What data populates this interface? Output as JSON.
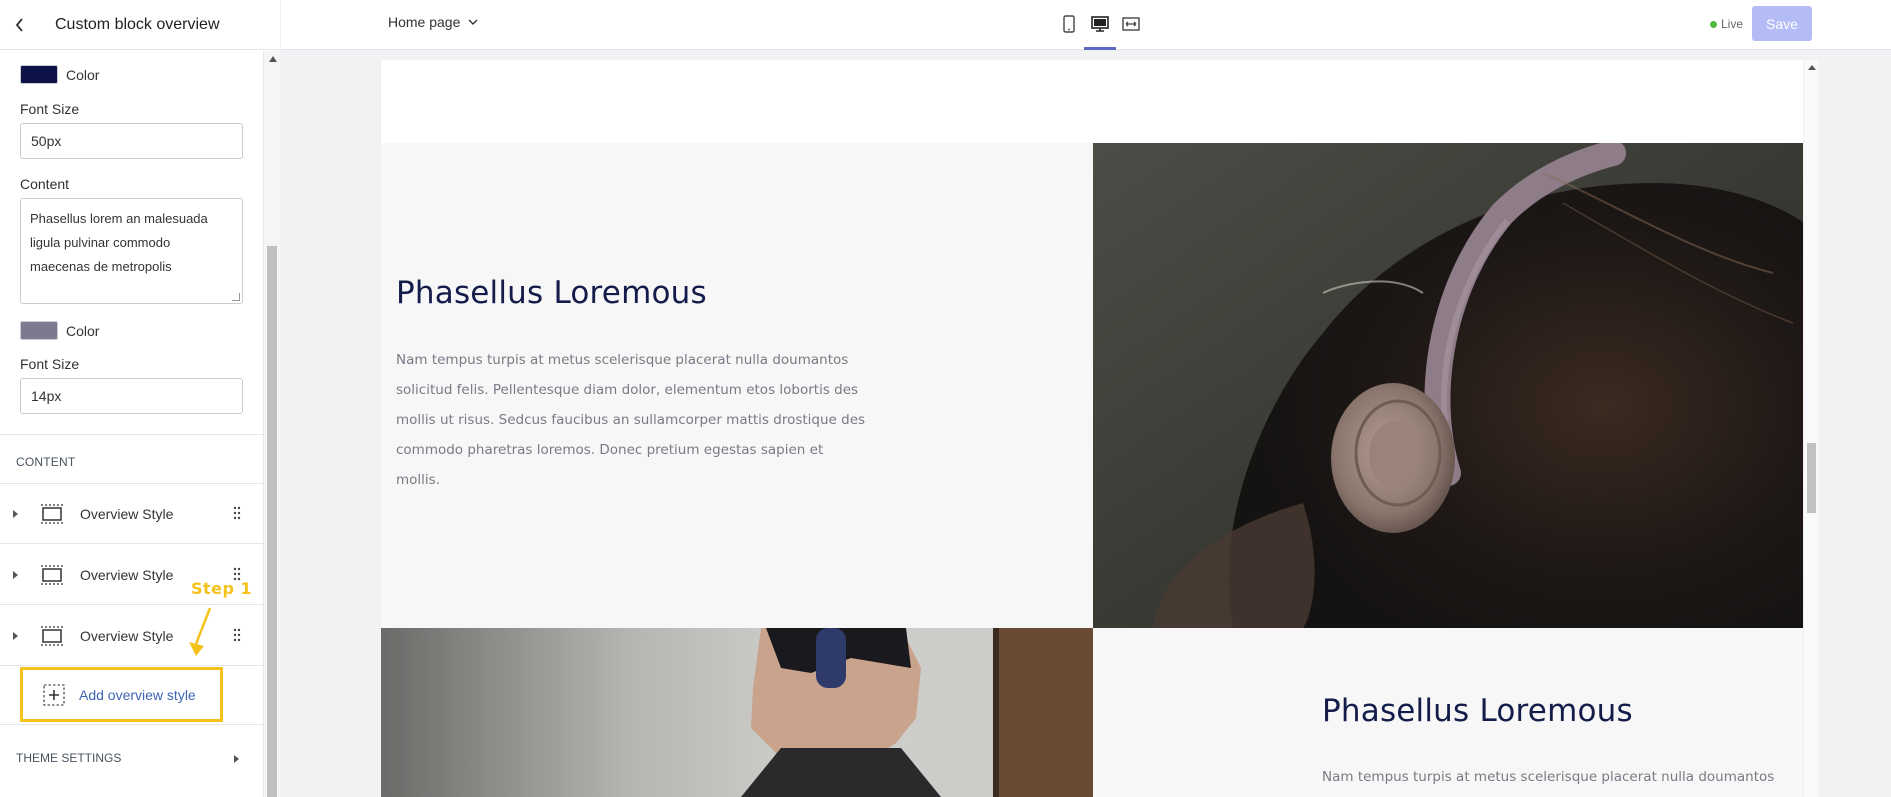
{
  "sidebar": {
    "title": "Custom block overview",
    "heading_color": {
      "label": "Color",
      "value": "#0e1347"
    },
    "heading_font_size": {
      "label": "Font Size",
      "value": "50px"
    },
    "content": {
      "label": "Content",
      "value": "Phasellus lorem an malesuada ligula pulvinar commodo maecenas de metropolis"
    },
    "content_color": {
      "label": "Color",
      "value": "#7b7a8e"
    },
    "content_font_size": {
      "label": "Font Size",
      "value": "14px"
    },
    "content_section": "CONTENT",
    "items": [
      {
        "label": "Overview Style"
      },
      {
        "label": "Overview Style"
      },
      {
        "label": "Overview Style"
      }
    ],
    "add_label": "Add overview style",
    "theme_settings": "THEME SETTINGS"
  },
  "annotation": {
    "step_label": "Step 1",
    "color": "#f4c21b"
  },
  "topbar": {
    "page_selector": "Home page",
    "devices": [
      "mobile-icon",
      "desktop-icon",
      "fullwidth-icon"
    ],
    "active_device": "desktop",
    "live_label": "Live",
    "save_label": "Save"
  },
  "preview": {
    "blocks": [
      {
        "heading": "Phasellus Loremous",
        "body_lines": [
          "Nam tempus turpis at metus scelerisque placerat nulla doumantos",
          "solicitud felis. Pellentesque diam dolor, elementum etos lobortis des",
          "mollis ut risus. Sedcus faucibus an sullamcorper mattis drostique des",
          "commodo pharetras loremos. Donec pretium egestas sapien et",
          "mollis."
        ],
        "image": "woman-with-headphones"
      },
      {
        "heading": "Phasellus Loremous",
        "body_lines": [
          "Nam tempus turpis at metus scelerisque placerat nulla doumantos"
        ],
        "image": "man-with-headphones"
      }
    ]
  }
}
